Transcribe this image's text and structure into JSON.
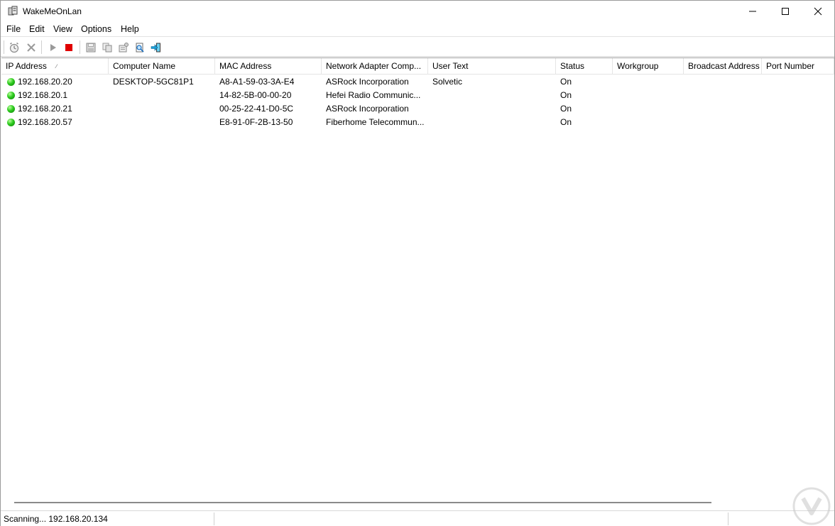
{
  "window": {
    "title": "WakeMeOnLan"
  },
  "menu": [
    "File",
    "Edit",
    "View",
    "Options",
    "Help"
  ],
  "toolbar": [
    {
      "icon": "alarm-clock-icon"
    },
    {
      "icon": "delete-x-icon"
    },
    {
      "icon": "play-icon"
    },
    {
      "icon": "stop-icon",
      "color": "#e00000"
    },
    {
      "icon": "save-icon"
    },
    {
      "icon": "copy-icon"
    },
    {
      "icon": "properties-icon"
    },
    {
      "icon": "find-icon"
    },
    {
      "icon": "exit-icon"
    }
  ],
  "table": {
    "sort_indicator": "∕",
    "columns": [
      "IP Address",
      "Computer Name",
      "MAC Address",
      "Network Adapter Comp...",
      "User Text",
      "Status",
      "Workgroup",
      "Broadcast Address",
      "Port Number"
    ],
    "rows": [
      [
        "192.168.20.20",
        "DESKTOP-5GC81P1",
        "A8-A1-59-03-3A-E4",
        "ASRock Incorporation",
        "Solvetic",
        "On",
        "",
        "",
        ""
      ],
      [
        "192.168.20.1",
        "",
        "14-82-5B-00-00-20",
        "Hefei Radio Communic...",
        "",
        "On",
        "",
        "",
        ""
      ],
      [
        "192.168.20.21",
        "",
        "00-25-22-41-D0-5C",
        "ASRock Incorporation",
        "",
        "On",
        "",
        "",
        ""
      ],
      [
        "192.168.20.57",
        "",
        "E8-91-0F-2B-13-50",
        "Fiberhome Telecommun...",
        "",
        "On",
        "",
        "",
        ""
      ]
    ]
  },
  "statusbar": {
    "text": "Scanning... 192.168.20.134"
  },
  "colors": {
    "status_on": "#2ecb1f",
    "stop": "#e00000",
    "exit_arrow": "#1a9fd6"
  }
}
